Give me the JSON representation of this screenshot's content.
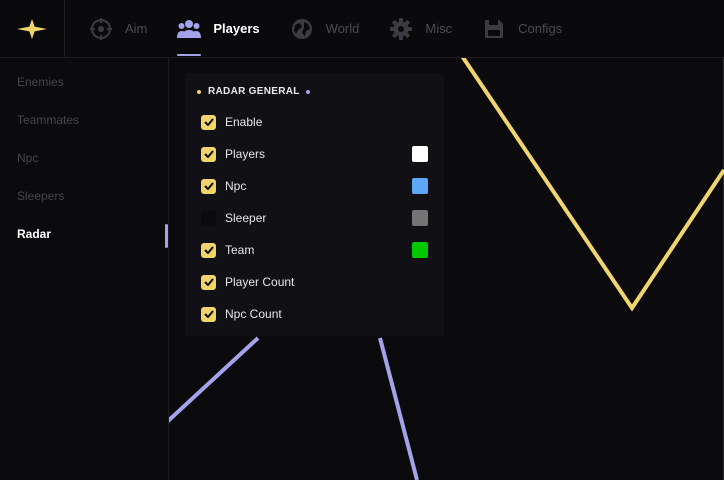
{
  "colors": {
    "accent_yellow": "#f2d46c",
    "accent_purple": "#a4a2ea",
    "background": "#0b0b0e",
    "panel": "#111115"
  },
  "logo": {
    "icon": "four-point-star-icon"
  },
  "nav": {
    "items": [
      {
        "label": "Aim",
        "icon": "crosshair-icon",
        "active": false
      },
      {
        "label": "Players",
        "icon": "users-icon",
        "active": true
      },
      {
        "label": "World",
        "icon": "globe-icon",
        "active": false
      },
      {
        "label": "Misc",
        "icon": "gear-icon",
        "active": false
      },
      {
        "label": "Configs",
        "icon": "save-icon",
        "active": false
      }
    ]
  },
  "sidebar": {
    "items": [
      {
        "label": "Enemies",
        "active": false
      },
      {
        "label": "Teammates",
        "active": false
      },
      {
        "label": "Npc",
        "active": false
      },
      {
        "label": "Sleepers",
        "active": false
      },
      {
        "label": "Radar",
        "active": true
      }
    ]
  },
  "panel": {
    "title": "RADAR GENERAL",
    "options": [
      {
        "label": "Enable",
        "checked": true,
        "color": null
      },
      {
        "label": "Players",
        "checked": true,
        "color": "#ffffff"
      },
      {
        "label": "Npc",
        "checked": true,
        "color": "#5ea8f7"
      },
      {
        "label": "Sleeper",
        "checked": false,
        "color": "#747474"
      },
      {
        "label": "Team",
        "checked": true,
        "color": "#00c800"
      },
      {
        "label": "Player Count",
        "checked": true,
        "color": null
      },
      {
        "label": "Npc Count",
        "checked": true,
        "color": null
      }
    ]
  }
}
